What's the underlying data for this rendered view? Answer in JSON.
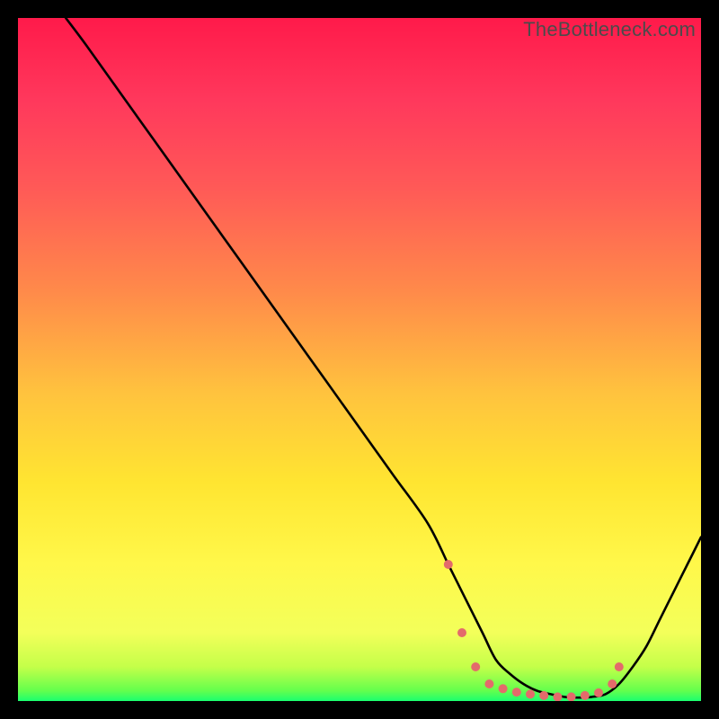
{
  "watermark": "TheBottleneck.com",
  "gradient_stops": [
    {
      "offset": 0.0,
      "color": "#ff1a4a"
    },
    {
      "offset": 0.12,
      "color": "#ff385c"
    },
    {
      "offset": 0.25,
      "color": "#ff5a57"
    },
    {
      "offset": 0.4,
      "color": "#ff8a4a"
    },
    {
      "offset": 0.55,
      "color": "#ffc33e"
    },
    {
      "offset": 0.68,
      "color": "#ffe531"
    },
    {
      "offset": 0.8,
      "color": "#fff84a"
    },
    {
      "offset": 0.9,
      "color": "#f3ff5a"
    },
    {
      "offset": 0.95,
      "color": "#c4ff49"
    },
    {
      "offset": 0.985,
      "color": "#63ff4d"
    },
    {
      "offset": 1.0,
      "color": "#1aff70"
    }
  ],
  "chart_data": {
    "type": "line",
    "title": "",
    "xlabel": "",
    "ylabel": "",
    "xlim": [
      0,
      100
    ],
    "ylim": [
      0,
      100
    ],
    "series": [
      {
        "name": "bottleneck-curve",
        "x": [
          7,
          10,
          15,
          20,
          25,
          30,
          35,
          40,
          45,
          50,
          55,
          60,
          63,
          65,
          68,
          70,
          72,
          74,
          76,
          78,
          80,
          82,
          84,
          86,
          88,
          90,
          92,
          94,
          96,
          98,
          100
        ],
        "y": [
          100,
          96,
          89,
          82,
          75,
          68,
          61,
          54,
          47,
          40,
          33,
          26,
          20,
          16,
          10,
          6,
          4,
          2.5,
          1.5,
          1,
          0.6,
          0.5,
          0.6,
          1,
          2.5,
          5,
          8,
          12,
          16,
          20,
          24
        ]
      }
    ],
    "highlight": {
      "name": "optimal-range-dots",
      "x": [
        63,
        65,
        67,
        69,
        71,
        73,
        75,
        77,
        79,
        81,
        83,
        85,
        87,
        88
      ],
      "y": [
        20,
        10,
        5,
        2.5,
        1.8,
        1.3,
        1,
        0.8,
        0.6,
        0.6,
        0.8,
        1.2,
        2.5,
        5
      ],
      "color": "#e36b6b",
      "radius_px": 5
    }
  }
}
